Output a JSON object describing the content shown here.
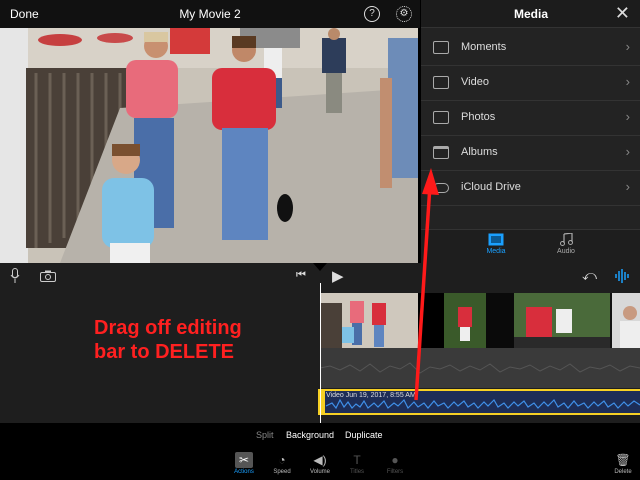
{
  "top_bar": {
    "done_label": "Done",
    "title": "My Movie 2",
    "help_label": "?",
    "settings_icon": "gear-icon"
  },
  "media_panel": {
    "title": "Media",
    "close_label": "✕",
    "items": [
      {
        "label": "Moments",
        "icon": "moments-icon"
      },
      {
        "label": "Video",
        "icon": "video-icon"
      },
      {
        "label": "Photos",
        "icon": "photos-icon"
      },
      {
        "label": "Albums",
        "icon": "albums-icon"
      },
      {
        "label": "iCloud Drive",
        "icon": "cloud-icon"
      }
    ],
    "chevron": "›",
    "tabs": [
      {
        "label": "Media",
        "icon": "media-tab-icon",
        "selected": true
      },
      {
        "label": "Audio",
        "icon": "music-note-icon",
        "selected": false
      }
    ]
  },
  "timeline": {
    "audio_clip_label": "Video Jun 19, 2017, 8:55 AM"
  },
  "annotation": {
    "text_line1": "Drag off editing",
    "text_line2": "bar to DELETE"
  },
  "bottom": {
    "options": {
      "split": "Split",
      "background": "Background",
      "duplicate": "Duplicate"
    },
    "tools": {
      "actions": "Actions",
      "speed": "Speed",
      "volume": "Volume",
      "titles": "Titles",
      "filters": "Filters",
      "delete": "Delete"
    }
  },
  "colors": {
    "accent_blue": "#1aa0ff",
    "selection_yellow": "#f6d024",
    "annotation_red": "#ff2020"
  }
}
